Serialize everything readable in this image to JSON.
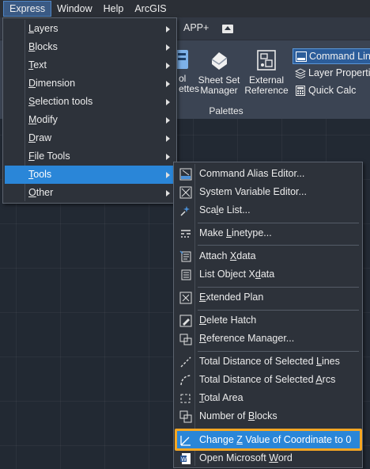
{
  "menubar": {
    "items": [
      {
        "label": "Express",
        "active": true
      },
      {
        "label": "Window",
        "active": false
      },
      {
        "label": "Help",
        "active": false
      },
      {
        "label": "ArcGIS",
        "active": false
      }
    ]
  },
  "ribbon": {
    "tab_label": "APP+",
    "buttons": {
      "tool_palettes_partial": "ol\nettes",
      "sheet_set_manager": "Sheet Set\nManager",
      "external_reference": "External\nReference"
    },
    "group_label": "Palettes",
    "side_items": [
      {
        "label": "Command Line",
        "selected": true,
        "icon": "command-line-icon"
      },
      {
        "label": "Layer Properties",
        "selected": false,
        "icon": "layer-properties-icon"
      },
      {
        "label": "Quick Calc",
        "selected": false,
        "icon": "calculator-icon"
      }
    ]
  },
  "express_menu": {
    "items": [
      {
        "label": "Layers",
        "accel": "L",
        "rest": "ayers",
        "has_submenu": true
      },
      {
        "label": "Blocks",
        "accel": "B",
        "rest": "locks",
        "has_submenu": true
      },
      {
        "label": "Text",
        "accel": "T",
        "rest": "ext",
        "has_submenu": true
      },
      {
        "label": "Dimension",
        "accel": "D",
        "rest": "imension",
        "has_submenu": true
      },
      {
        "label": "Selection tools",
        "accel": "S",
        "rest": "election tools",
        "has_submenu": true
      },
      {
        "label": "Modify",
        "accel": "M",
        "rest": "odify",
        "has_submenu": true
      },
      {
        "label": "Draw",
        "accel": "D",
        "rest": "raw",
        "has_submenu": true
      },
      {
        "label": "File Tools",
        "accel": "F",
        "rest": "ile Tools",
        "has_submenu": true
      },
      {
        "label": "Tools",
        "accel": "T",
        "rest": "ools",
        "has_submenu": true,
        "highlighted": true
      },
      {
        "label": "Other",
        "accel": "O",
        "rest": "ther",
        "has_submenu": true
      }
    ]
  },
  "tools_submenu": {
    "items": [
      {
        "pre": "Command Alias Editor...",
        "u": "",
        "post": "",
        "icon": "alias-editor-icon"
      },
      {
        "pre": "System Variable Editor...",
        "u": "",
        "post": "",
        "icon": "sysvar-editor-icon"
      },
      {
        "pre": "Sca",
        "u": "l",
        "post": "e List...",
        "icon": "scale-list-icon"
      },
      {
        "pre": "Make ",
        "u": "L",
        "post": "inetype...",
        "icon": "make-linetype-icon"
      },
      {
        "pre": "Attach ",
        "u": "X",
        "post": "data",
        "icon": "attach-xdata-icon"
      },
      {
        "pre": "List Object X",
        "u": "d",
        "post": "ata",
        "icon": "list-xdata-icon"
      },
      {
        "pre": "",
        "u": "E",
        "post": "xtended Plan",
        "icon": "extended-plan-icon"
      },
      {
        "pre": "",
        "u": "D",
        "post": "elete Hatch",
        "icon": "delete-hatch-icon"
      },
      {
        "pre": "",
        "u": "R",
        "post": "eference Manager...",
        "icon": "reference-manager-icon"
      },
      {
        "pre": "Total Distance of Selected ",
        "u": "L",
        "post": "ines",
        "icon": "distance-lines-icon"
      },
      {
        "pre": "Total Distance of Selected ",
        "u": "A",
        "post": "rcs",
        "icon": "distance-arcs-icon"
      },
      {
        "pre": "",
        "u": "T",
        "post": "otal Area",
        "icon": "total-area-icon"
      },
      {
        "pre": "Number of ",
        "u": "B",
        "post": "locks",
        "icon": "number-of-blocks-icon"
      },
      {
        "pre": "Change ",
        "u": "Z",
        "post": " Value of Coordinate to 0",
        "icon": "change-z-icon",
        "highlighted": true
      },
      {
        "pre": "Open Microsoft ",
        "u": "W",
        "post": "ord",
        "icon": "word-icon"
      }
    ]
  },
  "colors": {
    "menu_highlight": "#2a86d8",
    "callout_border": "#f5a623",
    "menu_bg": "#2d323a"
  }
}
